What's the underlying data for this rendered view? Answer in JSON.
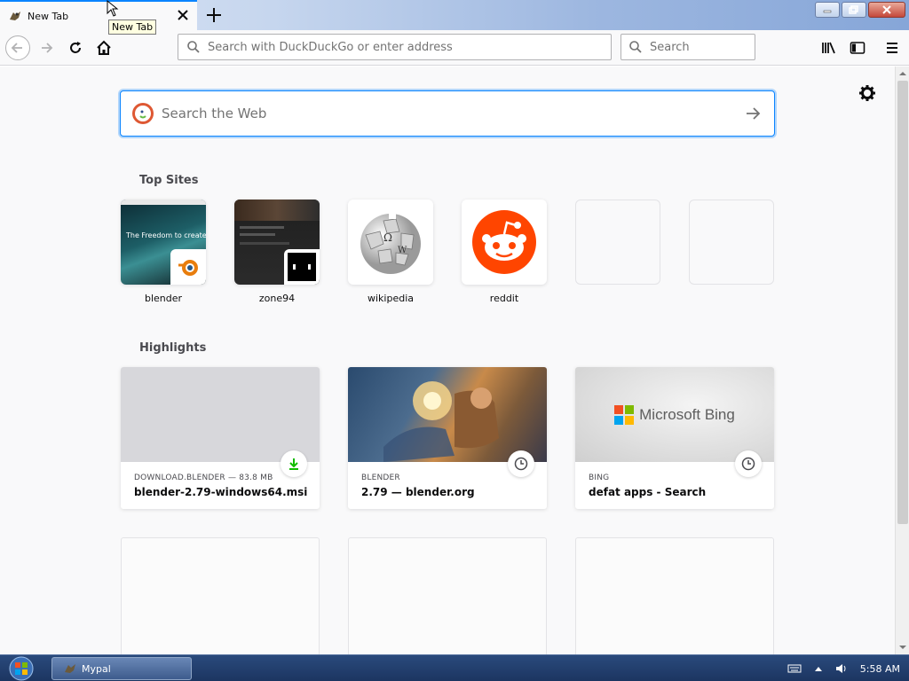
{
  "tab": {
    "title": "New Tab",
    "tooltip": "New Tab"
  },
  "toolbar": {
    "url_placeholder": "Search with DuckDuckGo or enter address",
    "search_placeholder": "Search"
  },
  "newtab": {
    "search_placeholder": "Search the Web",
    "top_sites_title": "Top Sites",
    "highlights_title": "Highlights",
    "top_sites": [
      {
        "label": "blender"
      },
      {
        "label": "zone94"
      },
      {
        "label": "wikipedia"
      },
      {
        "label": "reddit"
      }
    ],
    "highlights": [
      {
        "context": "DOWNLOAD.BLENDER — 83.8 MB",
        "title": "blender-2.79-windows64.msi",
        "badge": "download-icon"
      },
      {
        "context": "BLENDER",
        "title": "2.79 — blender.org",
        "badge": "clock-icon"
      },
      {
        "context": "BING",
        "title": "defat apps - Search",
        "badge": "clock-icon",
        "thumb_text": "Microsoft Bing"
      }
    ],
    "blender_thumb_text": "The Freedom to create"
  },
  "taskbar": {
    "window_title": "Mypal",
    "time": "5:58 AM"
  },
  "colors": {
    "accent": "#0a84ff",
    "reddit": "#ff4500",
    "download": "#12bc00"
  }
}
